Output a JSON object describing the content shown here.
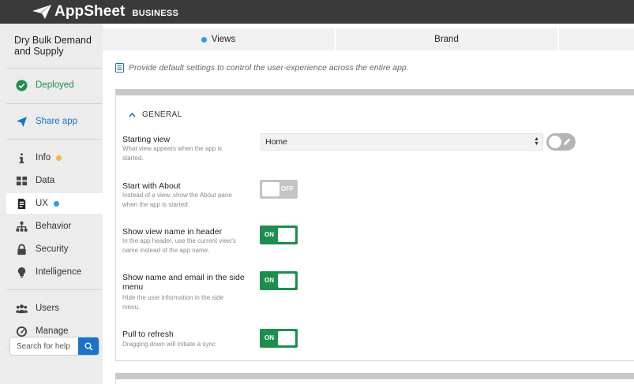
{
  "header": {
    "brand_name": "AppSheet",
    "brand_tier": "BUSINESS"
  },
  "sidebar": {
    "app_name": "Dry Bulk Demand and Supply",
    "deployed_label": "Deployed",
    "share_label": "Share app",
    "items": [
      {
        "label": "Info",
        "icon": "info-icon",
        "dot_color": "#f5b82e"
      },
      {
        "label": "Data",
        "icon": "grid-icon"
      },
      {
        "label": "UX",
        "icon": "mobile-icon",
        "dot_color": "#2d9be8",
        "active": true
      },
      {
        "label": "Behavior",
        "icon": "sitemap-icon"
      },
      {
        "label": "Security",
        "icon": "lock-icon"
      },
      {
        "label": "Intelligence",
        "icon": "lightbulb-icon"
      }
    ],
    "bottom_items": [
      {
        "label": "Users",
        "icon": "users-icon"
      },
      {
        "label": "Manage",
        "icon": "gauge-icon"
      }
    ],
    "search_placeholder": "Search for help"
  },
  "tabs": [
    {
      "label": "Views",
      "active_dot": true
    },
    {
      "label": "Brand"
    },
    {
      "label": ""
    }
  ],
  "main": {
    "description": "Provide default settings to control the user-experience across the entire app.",
    "section_title": "GENERAL",
    "settings": [
      {
        "label": "Starting view",
        "description": "What view appears when the app is started.",
        "control": "select",
        "value": "Home"
      },
      {
        "label": "Start with About",
        "description": "Instead of a view, show the About pane when the app is started.",
        "control": "toggle",
        "state": "OFF"
      },
      {
        "label": "Show view name in header",
        "description": "In the app header, use the current view's name instead of the app name.",
        "control": "toggle",
        "state": "ON"
      },
      {
        "label": "Show name and email in the side menu",
        "description": "Hide the user information in the side menu.",
        "control": "toggle",
        "state": "ON"
      },
      {
        "label": "Pull to refresh",
        "description": "Dragging down will initiate a sync",
        "control": "toggle",
        "state": "ON"
      }
    ]
  },
  "colors": {
    "topbar": "#3a3a3a",
    "accent_blue": "#1a73c9",
    "success_green": "#1e8e4e",
    "toggle_off": "#c4c4c4"
  }
}
